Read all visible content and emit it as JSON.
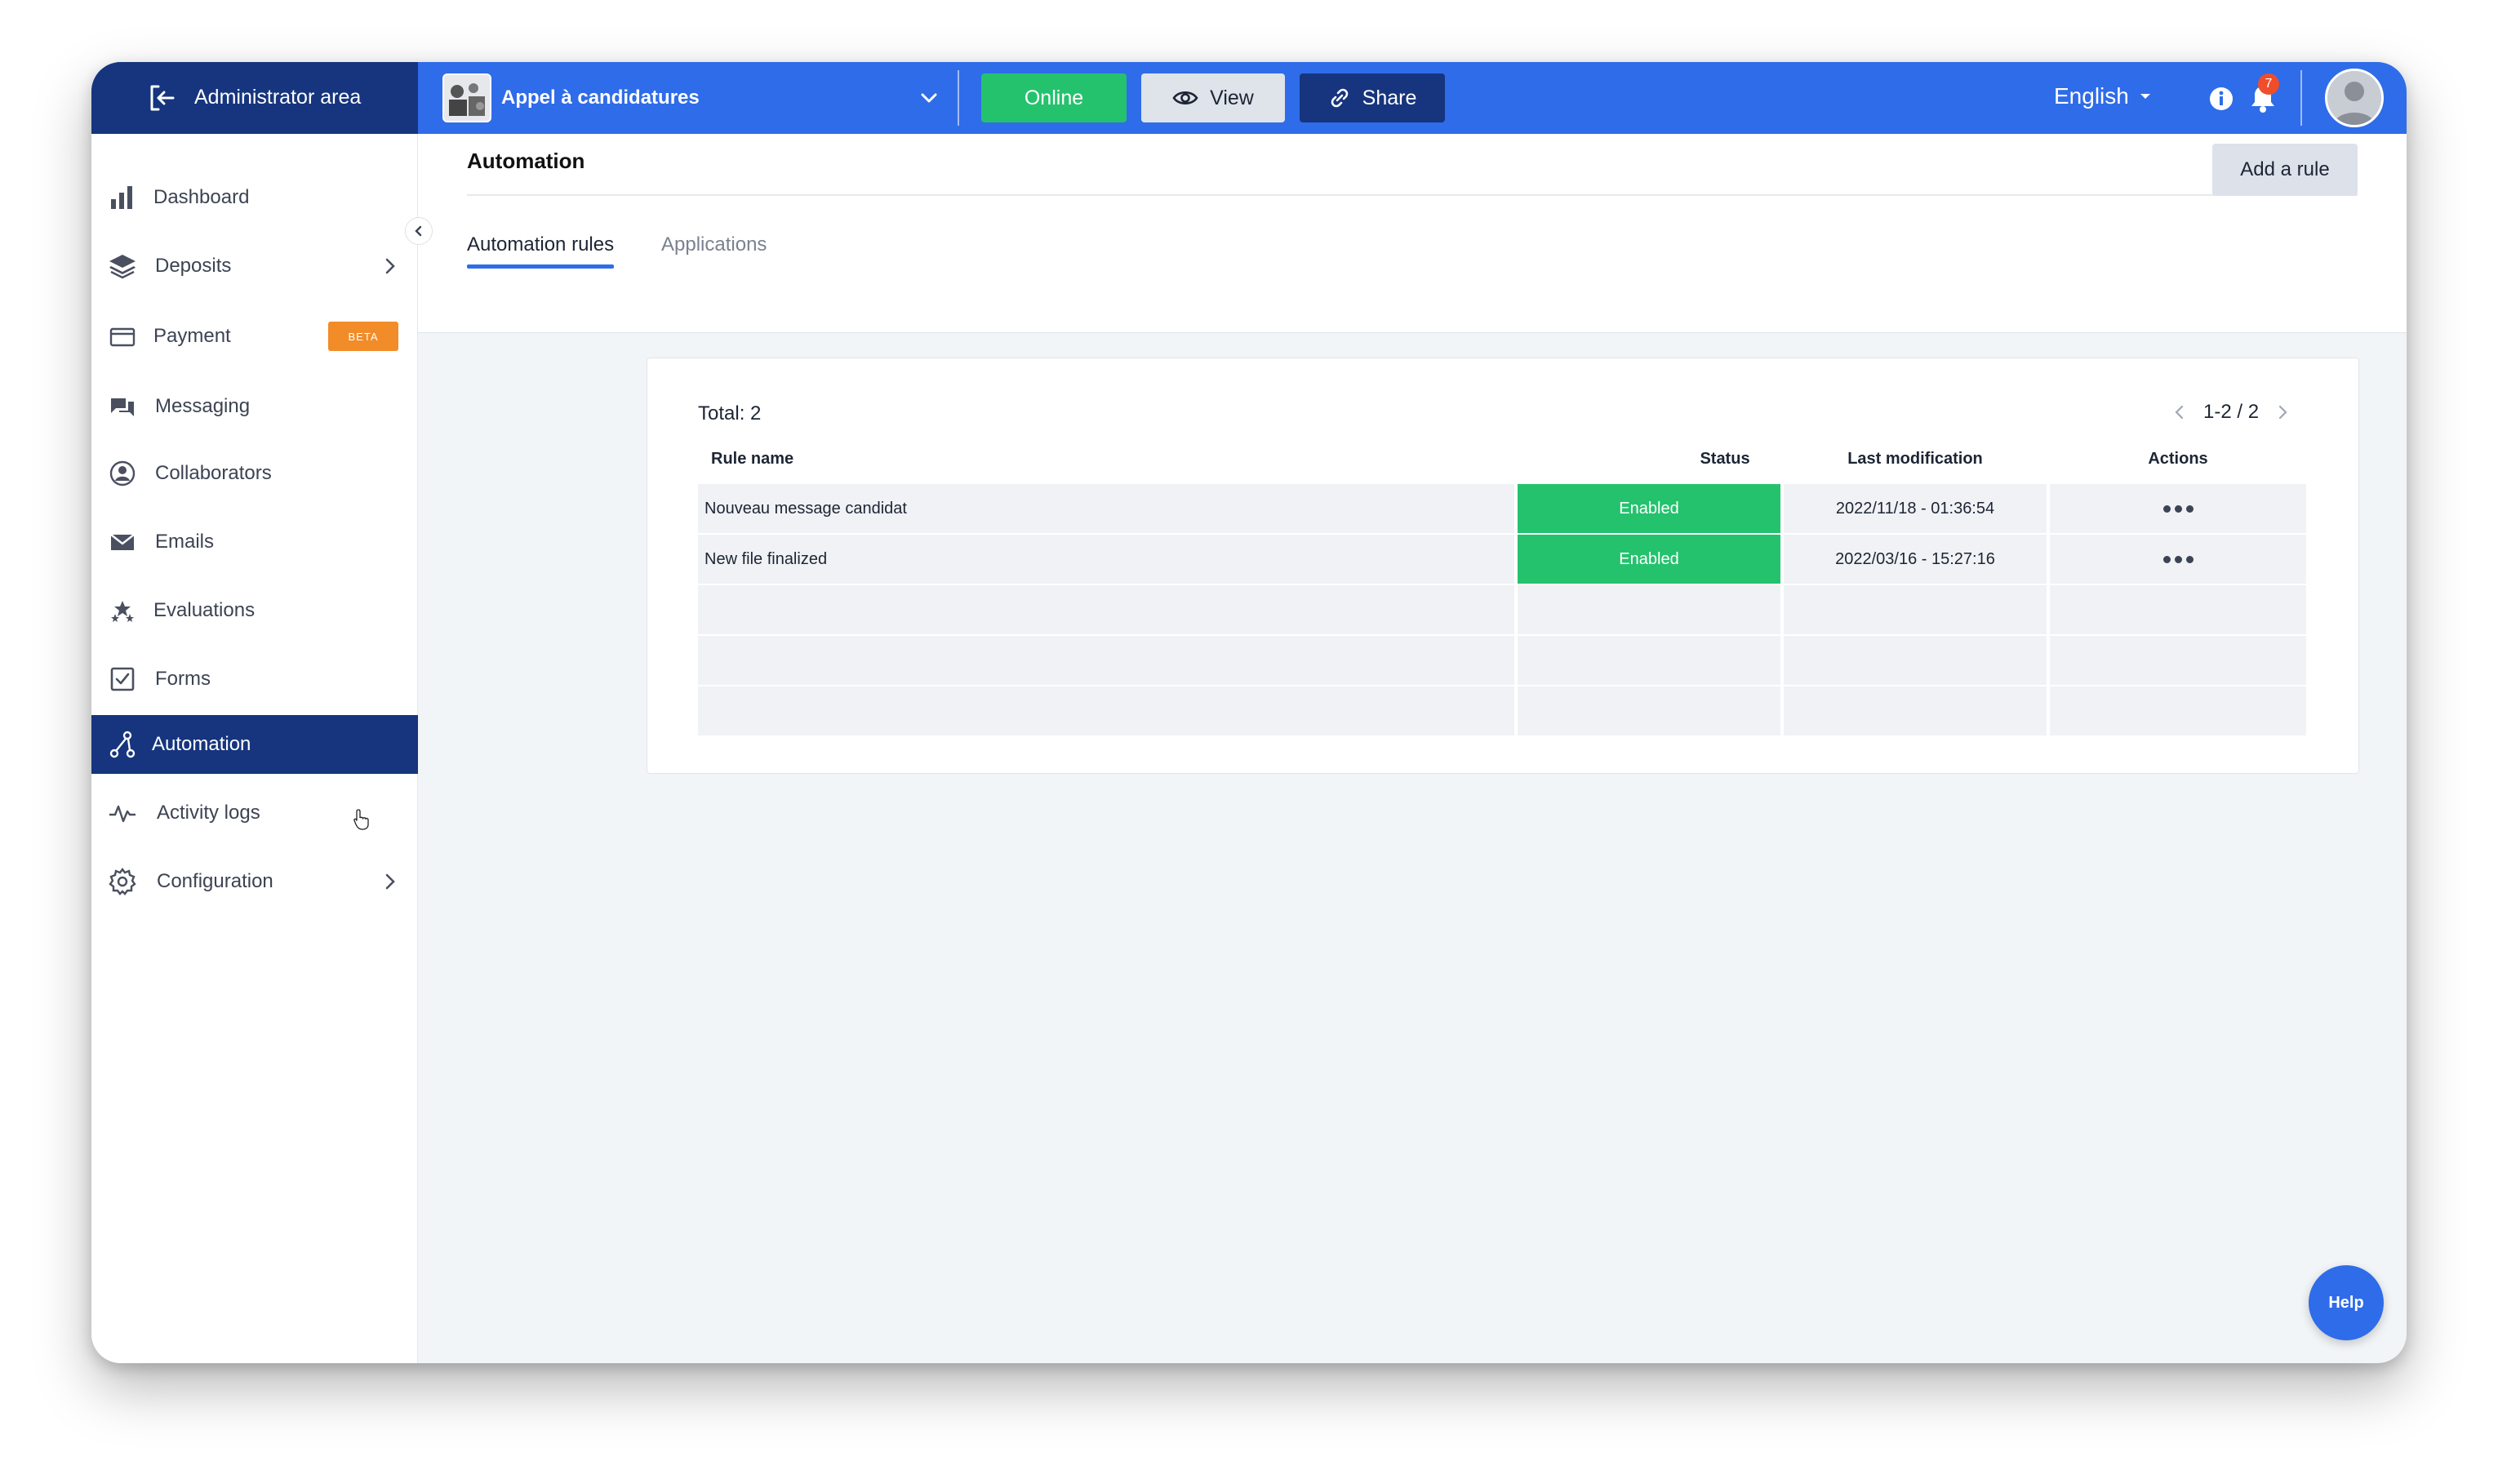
{
  "topbar": {
    "admin_area_label": "Administrator area",
    "project_title": "Appel à candidatures",
    "online_label": "Online",
    "view_label": "View",
    "share_label": "Share",
    "language": "English",
    "notification_count": "7"
  },
  "sidebar": {
    "items": [
      {
        "label": "Dashboard",
        "icon": "bar-chart-icon"
      },
      {
        "label": "Deposits",
        "icon": "layers-icon"
      },
      {
        "label": "Payment",
        "icon": "credit-card-icon",
        "badge": "BETA"
      },
      {
        "label": "Messaging",
        "icon": "chat-icon"
      },
      {
        "label": "Collaborators",
        "icon": "user-circle-icon"
      },
      {
        "label": "Emails",
        "icon": "envelope-icon"
      },
      {
        "label": "Evaluations",
        "icon": "stars-icon"
      },
      {
        "label": "Forms",
        "icon": "checkbox-icon"
      },
      {
        "label": "Automation",
        "icon": "automation-icon"
      },
      {
        "label": "Activity logs",
        "icon": "activity-icon"
      },
      {
        "label": "Configuration",
        "icon": "gear-icon"
      }
    ]
  },
  "main": {
    "title": "Automation",
    "add_rule_label": "Add a rule",
    "tabs": [
      {
        "label": "Automation rules"
      },
      {
        "label": "Applications"
      }
    ],
    "total_label": "Total: 2",
    "pagination": "1-2 / 2",
    "columns": {
      "name": "Rule name",
      "status": "Status",
      "modified": "Last modification",
      "actions": "Actions"
    },
    "rows": [
      {
        "name": "Nouveau message candidat",
        "status": "Enabled",
        "modified": "2022/11/18 - 01:36:54"
      },
      {
        "name": "New file finalized",
        "status": "Enabled",
        "modified": "2022/03/16 - 15:27:16"
      }
    ]
  },
  "help_label": "Help",
  "colors": {
    "primary": "#2f6ce9",
    "navy": "#16357e",
    "success": "#25c26e",
    "beta": "#f28c28"
  }
}
